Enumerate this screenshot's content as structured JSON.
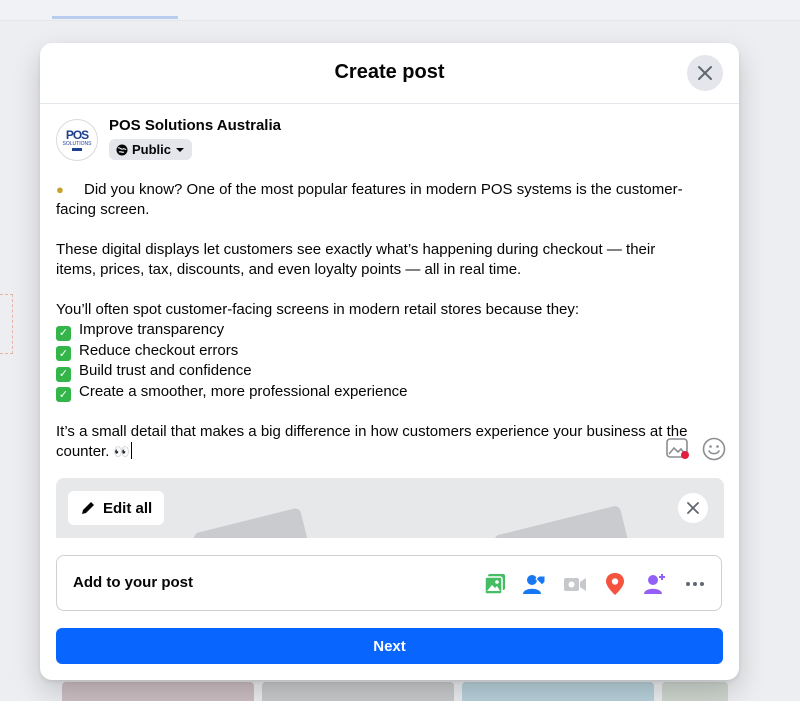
{
  "modal": {
    "title": "Create post"
  },
  "author": {
    "name": "POS Solutions Australia",
    "avatar_text": "POS",
    "avatar_subtext": "SOLUTIONS",
    "privacy": "Public"
  },
  "post": {
    "line1": "Did you know? One of the most popular features in modern POS systems is the customer-facing screen.",
    "line2": "These digital displays let customers see exactly what’s happening during checkout — their items, prices, tax, discounts, and even loyalty points — all in real time.",
    "line3": "You’ll often spot customer-facing screens in modern retail stores because they:",
    "checks": [
      "Improve transparency",
      "Reduce checkout errors",
      "Build trust and confidence",
      "Create a smoother, more professional experience"
    ],
    "line4": "It’s a small detail that makes a big difference in how customers experience your business at the counter.",
    "eyes": "👀"
  },
  "media": {
    "edit_all_label": "Edit all"
  },
  "add_to_post": {
    "label": "Add to your post",
    "icons": [
      "photo-video-icon",
      "tag-people-icon",
      "live-video-icon",
      "location-pin-icon",
      "add-person-icon",
      "more-icon"
    ]
  },
  "next_label": "Next",
  "colors": {
    "primary": "#0866ff",
    "check_green": "#33b54a",
    "photo_green": "#45bd62",
    "tag_blue": "#1877f2",
    "location_red": "#f5533d",
    "person_purple": "#9360f7"
  }
}
